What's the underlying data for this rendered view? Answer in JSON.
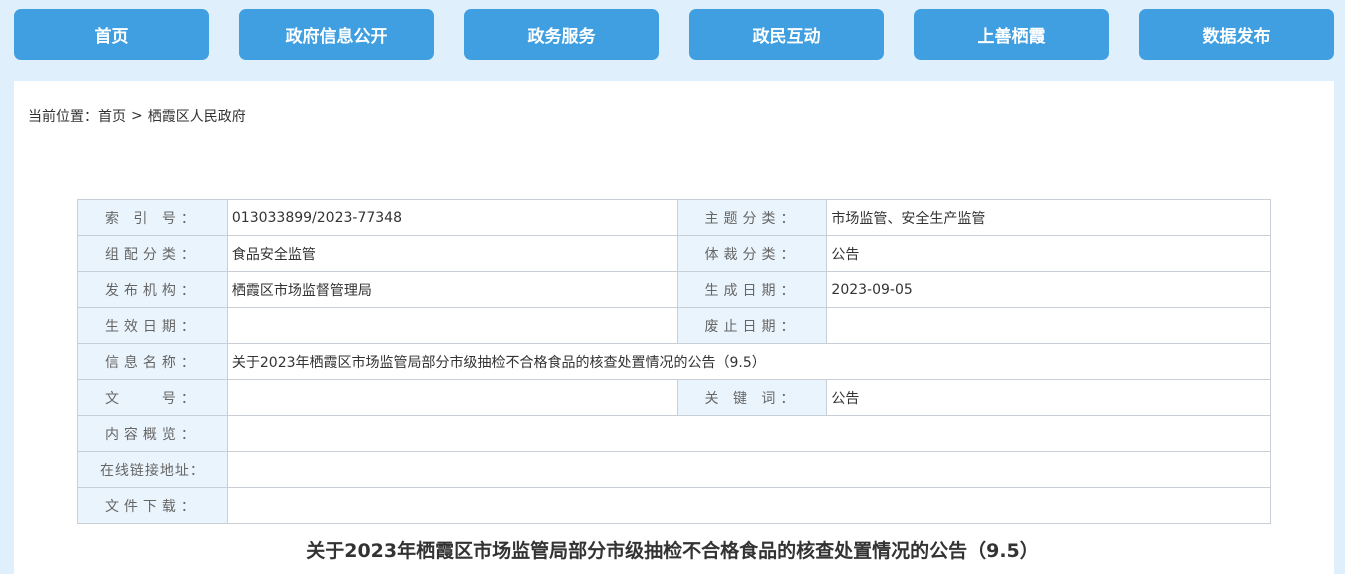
{
  "nav": {
    "items": [
      {
        "label": "首页"
      },
      {
        "label": "政府信息公开"
      },
      {
        "label": "政务服务"
      },
      {
        "label": "政民互动"
      },
      {
        "label": "上善栖霞"
      },
      {
        "label": "数据发布"
      }
    ]
  },
  "breadcrumb": {
    "prefix": "当前位置：",
    "home": "首页",
    "separator": ">",
    "current": "栖霞区人民政府"
  },
  "meta": {
    "index_label": "索 引 号：",
    "index_value": "013033899/2023-77348",
    "topic_label": "主题分类：",
    "topic_value": "市场监管、安全生产监管",
    "org_class_label": "组配分类：",
    "org_class_value": "食品安全监管",
    "genre_label": "体裁分类：",
    "genre_value": "公告",
    "publisher_label": "发布机构：",
    "publisher_value": "栖霞区市场监督管理局",
    "created_label": "生成日期：",
    "created_value": "2023-09-05",
    "effective_label": "生效日期：",
    "effective_value": "",
    "expire_label": "废止日期：",
    "expire_value": "",
    "name_label": "信息名称：",
    "name_value": "关于2023年栖霞区市场监管局部分市级抽检不合格食品的核查处置情况的公告（9.5）",
    "docno_label": "文　　号：",
    "docno_value": "",
    "keyword_label": "关 键 词：",
    "keyword_value": "公告",
    "summary_label": "内容概览：",
    "summary_value": "",
    "link_label": "在线链接地址：",
    "link_value": "",
    "download_label": "文件下载：",
    "download_value": ""
  },
  "document": {
    "title": "关于2023年栖霞区市场监管局部分市级抽检不合格食品的核查处置情况的公告（9.5）"
  }
}
